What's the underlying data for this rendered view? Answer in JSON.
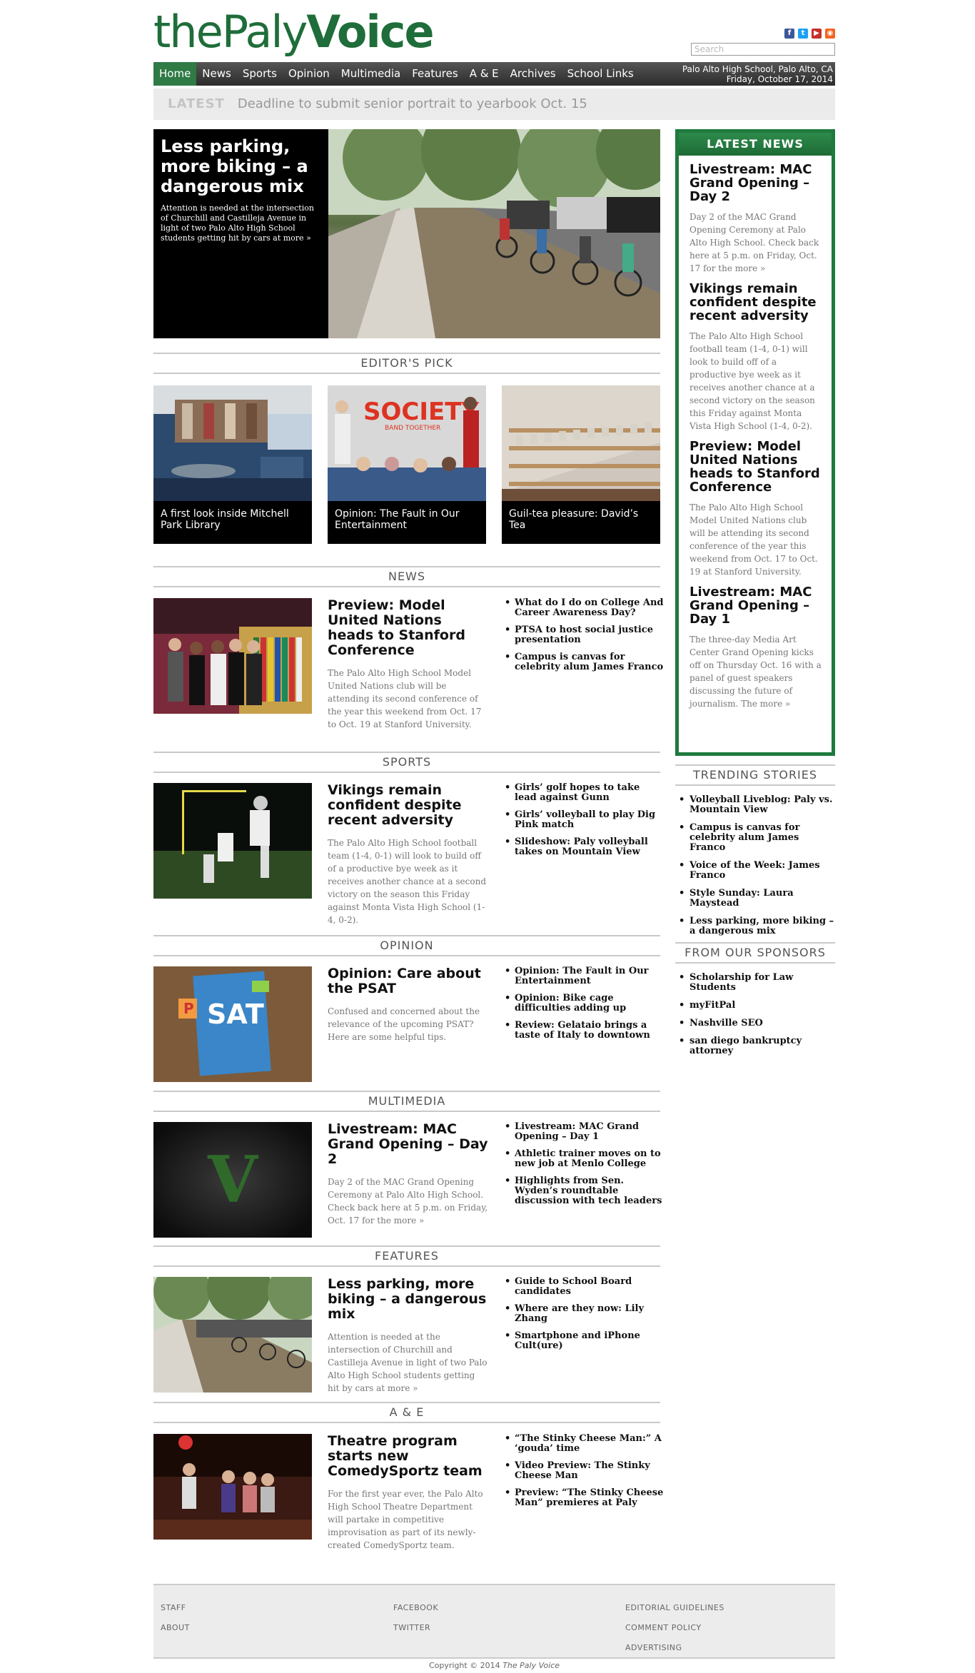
{
  "brand": {
    "part1": "thePaly",
    "part2": "Voice"
  },
  "header": {
    "search_placeholder": "Search",
    "social": [
      {
        "name": "facebook-icon",
        "glyph": "f",
        "color": "#3b5998"
      },
      {
        "name": "twitter-icon",
        "glyph": "t",
        "color": "#1da1f2"
      },
      {
        "name": "youtube-icon",
        "glyph": "▶",
        "color": "#c4302b"
      },
      {
        "name": "rss-icon",
        "glyph": "◉",
        "color": "#f26522"
      }
    ]
  },
  "nav": {
    "items": [
      "Home",
      "News",
      "Sports",
      "Opinion",
      "Multimedia",
      "Features",
      "A & E",
      "Archives",
      "School Links"
    ],
    "location": "Palo Alto High School, Palo Alto, CA",
    "date": "Friday, October 17, 2014"
  },
  "latest": {
    "label": "LATEST",
    "text": "Deadline to submit senior portrait to yearbook Oct. 15"
  },
  "feature": {
    "title": "Less parking, more biking – a dangerous mix",
    "summary": "Attention is needed at the intersection of Churchill and Castilleja Avenue in light of two Palo Alto High School students getting hit by cars at more »"
  },
  "editors_pick": {
    "heading": "EDITOR'S PICK",
    "items": [
      {
        "caption": "A first look inside Mitchell Park Library"
      },
      {
        "caption": "Opinion: The Fault in Our Entertainment"
      },
      {
        "caption": "Guil-tea pleasure: David’s Tea"
      }
    ]
  },
  "sections": [
    {
      "heading": "NEWS",
      "title": "Preview: Model United Nations heads to Stanford Conference",
      "summary": "The Palo Alto High School Model United Nations club will be attending its second conference of the year this weekend from Oct. 17 to Oct. 19 at Stanford University.",
      "links": [
        "What do I do on College And Career Awareness Day?",
        "PTSA to host social justice presentation",
        "Campus is canvas for celebrity alum James Franco"
      ]
    },
    {
      "heading": "SPORTS",
      "title": "Vikings remain confident despite recent adversity",
      "summary": "The Palo Alto High School football team (1-4, 0-1) will look to build off of a productive bye week as it receives another chance at a second victory on the season this Friday against Monta Vista High School (1-4, 0-2).",
      "links": [
        "Girls’ golf hopes to take lead against Gunn",
        "Girls’ volleyball to play Dig Pink match",
        "Slideshow: Paly volleyball takes on Mountain View"
      ]
    },
    {
      "heading": "OPINION",
      "title": "Opinion: Care about the PSAT",
      "summary": "Confused and concerned about the relevance of the upcoming PSAT? Here are some helpful tips.",
      "links": [
        "Opinion: The Fault in Our Entertainment",
        "Opinion: Bike cage difficulties adding up",
        "Review: Gelataio brings a taste of Italy to downtown"
      ]
    },
    {
      "heading": "MULTIMEDIA",
      "title": "Livestream: MAC Grand Opening – Day 2",
      "summary": "Day 2 of the MAC Grand Opening Ceremony at Palo Alto High School. Check back here at 5 p.m. on Friday, Oct. 17 for the more »",
      "links": [
        "Livestream: MAC Grand Opening – Day 1",
        "Athletic trainer moves on to new job at Menlo College",
        "Highlights from Sen. Wyden’s roundtable discussion with tech leaders"
      ]
    },
    {
      "heading": "FEATURES",
      "title": "Less parking, more biking – a dangerous mix",
      "summary": "Attention is needed at the intersection of Churchill and Castilleja Avenue in light of two Palo Alto High School students getting hit by cars at more »",
      "links": [
        "Guide to School Board candidates",
        "Where are they now: Lily Zhang",
        "Smartphone and iPhone Cult(ure)"
      ]
    },
    {
      "heading": "A & E",
      "title": "Theatre program starts new ComedySportz team",
      "summary": "For the first year ever, the Palo Alto High School Theatre Department will partake in competitive improvisation as part of its newly-created ComedySportz team.",
      "links": [
        "“The Stinky Cheese Man:” A ‘gouda’ time",
        "Video Preview: The Stinky Cheese Man",
        "Preview: “The Stinky Cheese Man” premieres at Paly"
      ]
    }
  ],
  "sidebar": {
    "latest_news": {
      "heading": "LATEST NEWS",
      "items": [
        {
          "title": "Livestream: MAC Grand Opening – Day 2",
          "summary": "Day 2 of the MAC Grand Opening Ceremony at Palo Alto High School. Check back here at 5 p.m. on Friday, Oct. 17 for the more »"
        },
        {
          "title": "Vikings remain confident despite recent adversity",
          "summary": "The Palo Alto High School football team (1-4, 0-1) will look to build off of a productive bye week as it receives another chance at a second victory on the season this Friday against Monta Vista High School (1-4, 0-2)."
        },
        {
          "title": "Preview: Model United Nations heads to Stanford Conference",
          "summary": "The Palo Alto High School Model United Nations club will be attending its second conference of the year this weekend from Oct. 17 to Oct. 19 at Stanford University."
        },
        {
          "title": "Livestream: MAC Grand Opening – Day 1",
          "summary": "The three-day Media Art Center Grand Opening kicks off on Thursday Oct. 16 with a panel of guest speakers discussing the future of journalism. The more »"
        }
      ]
    },
    "trending": {
      "heading": "TRENDING STORIES",
      "items": [
        "Volleyball Liveblog: Paly vs. Mountain View",
        "Campus is canvas for celebrity alum James Franco",
        "Voice of the Week: James Franco",
        "Style Sunday: Laura Maystead",
        "Less parking, more biking – a dangerous mix"
      ]
    },
    "sponsors": {
      "heading": "FROM OUR SPONSORS",
      "items": [
        "Scholarship for Law Students",
        "myFitPal",
        "Nashville SEO",
        "san diego bankruptcy attorney"
      ]
    }
  },
  "footer": {
    "col1": [
      "STAFF",
      "ABOUT"
    ],
    "col2": [
      "FACEBOOK",
      "TWITTER"
    ],
    "col3": [
      "EDITORIAL GUIDELINES",
      "COMMENT POLICY",
      "ADVERTISING"
    ],
    "copyright": "Copyright © 2014",
    "copyright_name": "The Paly Voice"
  }
}
